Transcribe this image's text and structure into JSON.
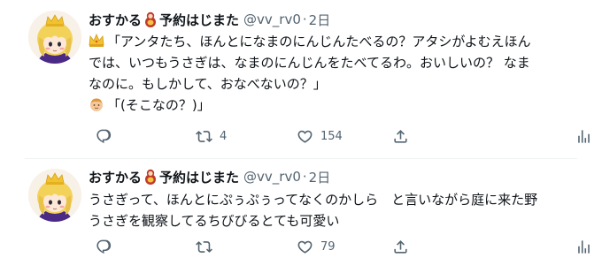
{
  "tweets": [
    {
      "display_name": "おすかる",
      "display_name_suffix": "予約はじまた",
      "handle": "@vv_rv0",
      "separator": "·",
      "time": "2日",
      "lines": [
        "「アンタたち、ほんとになまのにんじんたべるの？アタシがよむえほん",
        "では、いつもうさぎは、なまのにんじんをたべてるわ。おいしいの？ なま",
        "なのに。もしかして、おなべないの？」",
        "「(そこなの？)」"
      ],
      "line_emojis": [
        "crown-emoji",
        "",
        "",
        "person-emoji"
      ],
      "reply_count": "",
      "retweet_count": "4",
      "like_count": "154"
    },
    {
      "display_name": "おすかる",
      "display_name_suffix": "予約はじまた",
      "handle": "@vv_rv0",
      "separator": "·",
      "time": "2日",
      "lines": [
        "うさぎって、ほんとにぷぅぷぅってなくのかしら　と言いながら庭に来た野",
        "うさぎを観察してるちびびるとても可愛い"
      ],
      "reply_count": "",
      "retweet_count": "",
      "like_count": "79"
    }
  ],
  "icons": {
    "reply": "reply-icon",
    "retweet": "retweet-icon",
    "like": "heart-icon",
    "share": "share-icon",
    "analytics": "analytics-icon",
    "doll": "matryoshka-doll-icon",
    "avatar": "avatar"
  },
  "colors": {
    "text": "#0f1419",
    "secondary": "#536471",
    "divider": "#eff3f4"
  }
}
